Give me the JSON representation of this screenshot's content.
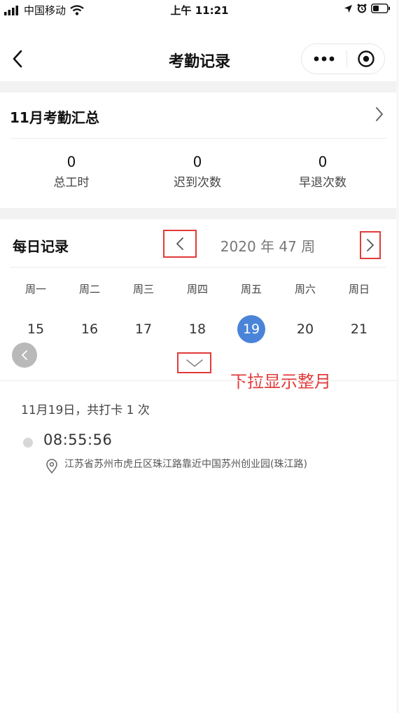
{
  "status_bar": {
    "carrier": "中国移动",
    "time": "上午 11:21"
  },
  "nav": {
    "title": "考勤记录",
    "back_icon": "chevron-left-icon",
    "menu_icon": "more-dots-icon",
    "close_icon": "target-close-icon"
  },
  "summary": {
    "title": "11月考勤汇总",
    "stats": [
      {
        "value": "0",
        "label": "总工时"
      },
      {
        "value": "0",
        "label": "迟到次数"
      },
      {
        "value": "0",
        "label": "早退次数"
      }
    ]
  },
  "daily": {
    "title": "每日记录",
    "week_label": "2020 年 47 周",
    "weekdays": [
      "周一",
      "周二",
      "周三",
      "周四",
      "周五",
      "周六",
      "周日"
    ],
    "days": [
      "15",
      "16",
      "17",
      "18",
      "19",
      "20",
      "21"
    ],
    "selected_day": "19",
    "expand_hint": "下拉显示整月"
  },
  "record": {
    "date_summary": "11月19日，共打卡 1 次",
    "entries": [
      {
        "time": "08:55:56",
        "address": "江苏省苏州市虎丘区珠江路靠近中国苏州创业园(珠江路)"
      }
    ]
  },
  "colors": {
    "accent": "#4a84d8",
    "annotation_red": "#e23a3a",
    "band_gray": "#f2f2f2"
  }
}
